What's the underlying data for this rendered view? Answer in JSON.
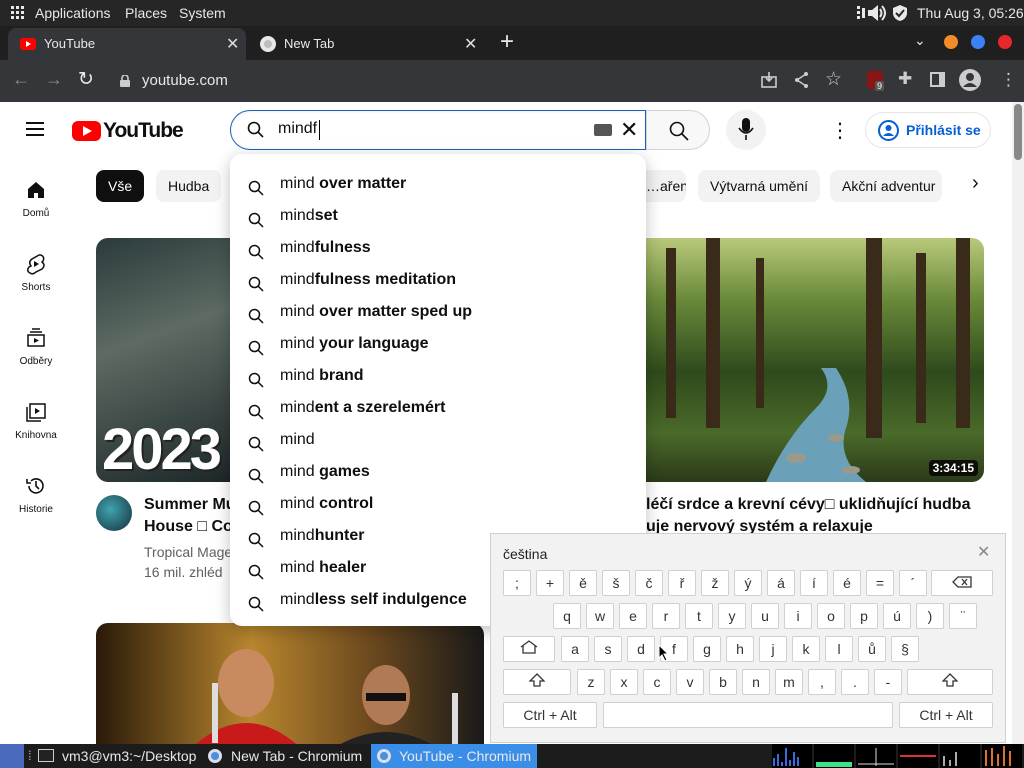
{
  "top_panel": {
    "applications": "Applications",
    "places": "Places",
    "system": "System",
    "clock": "Thu Aug  3, 05:26"
  },
  "tabs": [
    {
      "title": "YouTube",
      "active": true
    },
    {
      "title": "New Tab",
      "active": false
    }
  ],
  "toolbar": {
    "url": "youtube.com",
    "ext_badge": "9"
  },
  "youtube": {
    "logo_text": "YouTube",
    "search_value": "mindf",
    "sign_in": "Přihlásit se",
    "chips": [
      "Vše",
      "Hudba",
      "…aření",
      "Výtvarná umění",
      "Akční adventur"
    ],
    "nav": [
      {
        "label": "Domů",
        "icon": "home-icon"
      },
      {
        "label": "Shorts",
        "icon": "shorts-icon"
      },
      {
        "label": "Odběry",
        "icon": "subscriptions-icon"
      },
      {
        "label": "Knihovna",
        "icon": "library-icon"
      },
      {
        "label": "Historie",
        "icon": "history-icon"
      }
    ],
    "suggestions": [
      {
        "prefix": "mind",
        "rest": " over matter"
      },
      {
        "prefix": "mind",
        "rest": "set"
      },
      {
        "prefix": "mind",
        "rest": "fulness"
      },
      {
        "prefix": "mind",
        "rest": "fulness meditation"
      },
      {
        "prefix": "mind",
        "rest": " over matter sped up"
      },
      {
        "prefix": "mind",
        "rest": " your language"
      },
      {
        "prefix": "mind",
        "rest": " brand"
      },
      {
        "prefix": "mind",
        "rest": "ent a szerelemért"
      },
      {
        "prefix": "mind",
        "rest": ""
      },
      {
        "prefix": "mind",
        "rest": " games"
      },
      {
        "prefix": "mind",
        "rest": " control"
      },
      {
        "prefix": "mind",
        "rest": "hunter"
      },
      {
        "prefix": "mind",
        "rest": " healer"
      },
      {
        "prefix": "mind",
        "rest": "less self indulgence"
      }
    ],
    "video1": {
      "thumb_text": "2023",
      "title_line1": "Summer Mu",
      "title_line2": "House □ Co",
      "channel": "Tropical Mage",
      "meta": "16 mil. zhléd"
    },
    "video2": {
      "duration": "3:34:15",
      "title_line1": "léčí srdce a krevní cévy□ uklidňující hudba",
      "title_line2": "uje nervový systém a relaxuje"
    }
  },
  "keyboard": {
    "language": "čeština",
    "row1": [
      ";",
      "+",
      "ě",
      "š",
      "č",
      "ř",
      "ž",
      "ý",
      "á",
      "í",
      "é",
      "=",
      "´"
    ],
    "row2": [
      "q",
      "w",
      "e",
      "r",
      "t",
      "y",
      "u",
      "i",
      "o",
      "p",
      "ú",
      ")",
      "¨"
    ],
    "row3": [
      "a",
      "s",
      "d",
      "f",
      "g",
      "h",
      "j",
      "k",
      "l",
      "ů",
      "§"
    ],
    "row4": [
      "z",
      "x",
      "c",
      "v",
      "b",
      "n",
      "m",
      ",",
      ".",
      "-"
    ],
    "ctrl_alt_left": "Ctrl + Alt",
    "ctrl_alt_right": "Ctrl + Alt"
  },
  "taskbar": {
    "items": [
      {
        "label": "vm3@vm3:~/Desktop"
      },
      {
        "label": "New Tab - Chromium"
      },
      {
        "label": "YouTube - Chromium"
      }
    ]
  },
  "colors": {
    "yt_red": "#ff0000",
    "link_blue": "#065fd4",
    "chrome_dark": "#35363a",
    "taskbar_active": "#3b8ee8"
  }
}
